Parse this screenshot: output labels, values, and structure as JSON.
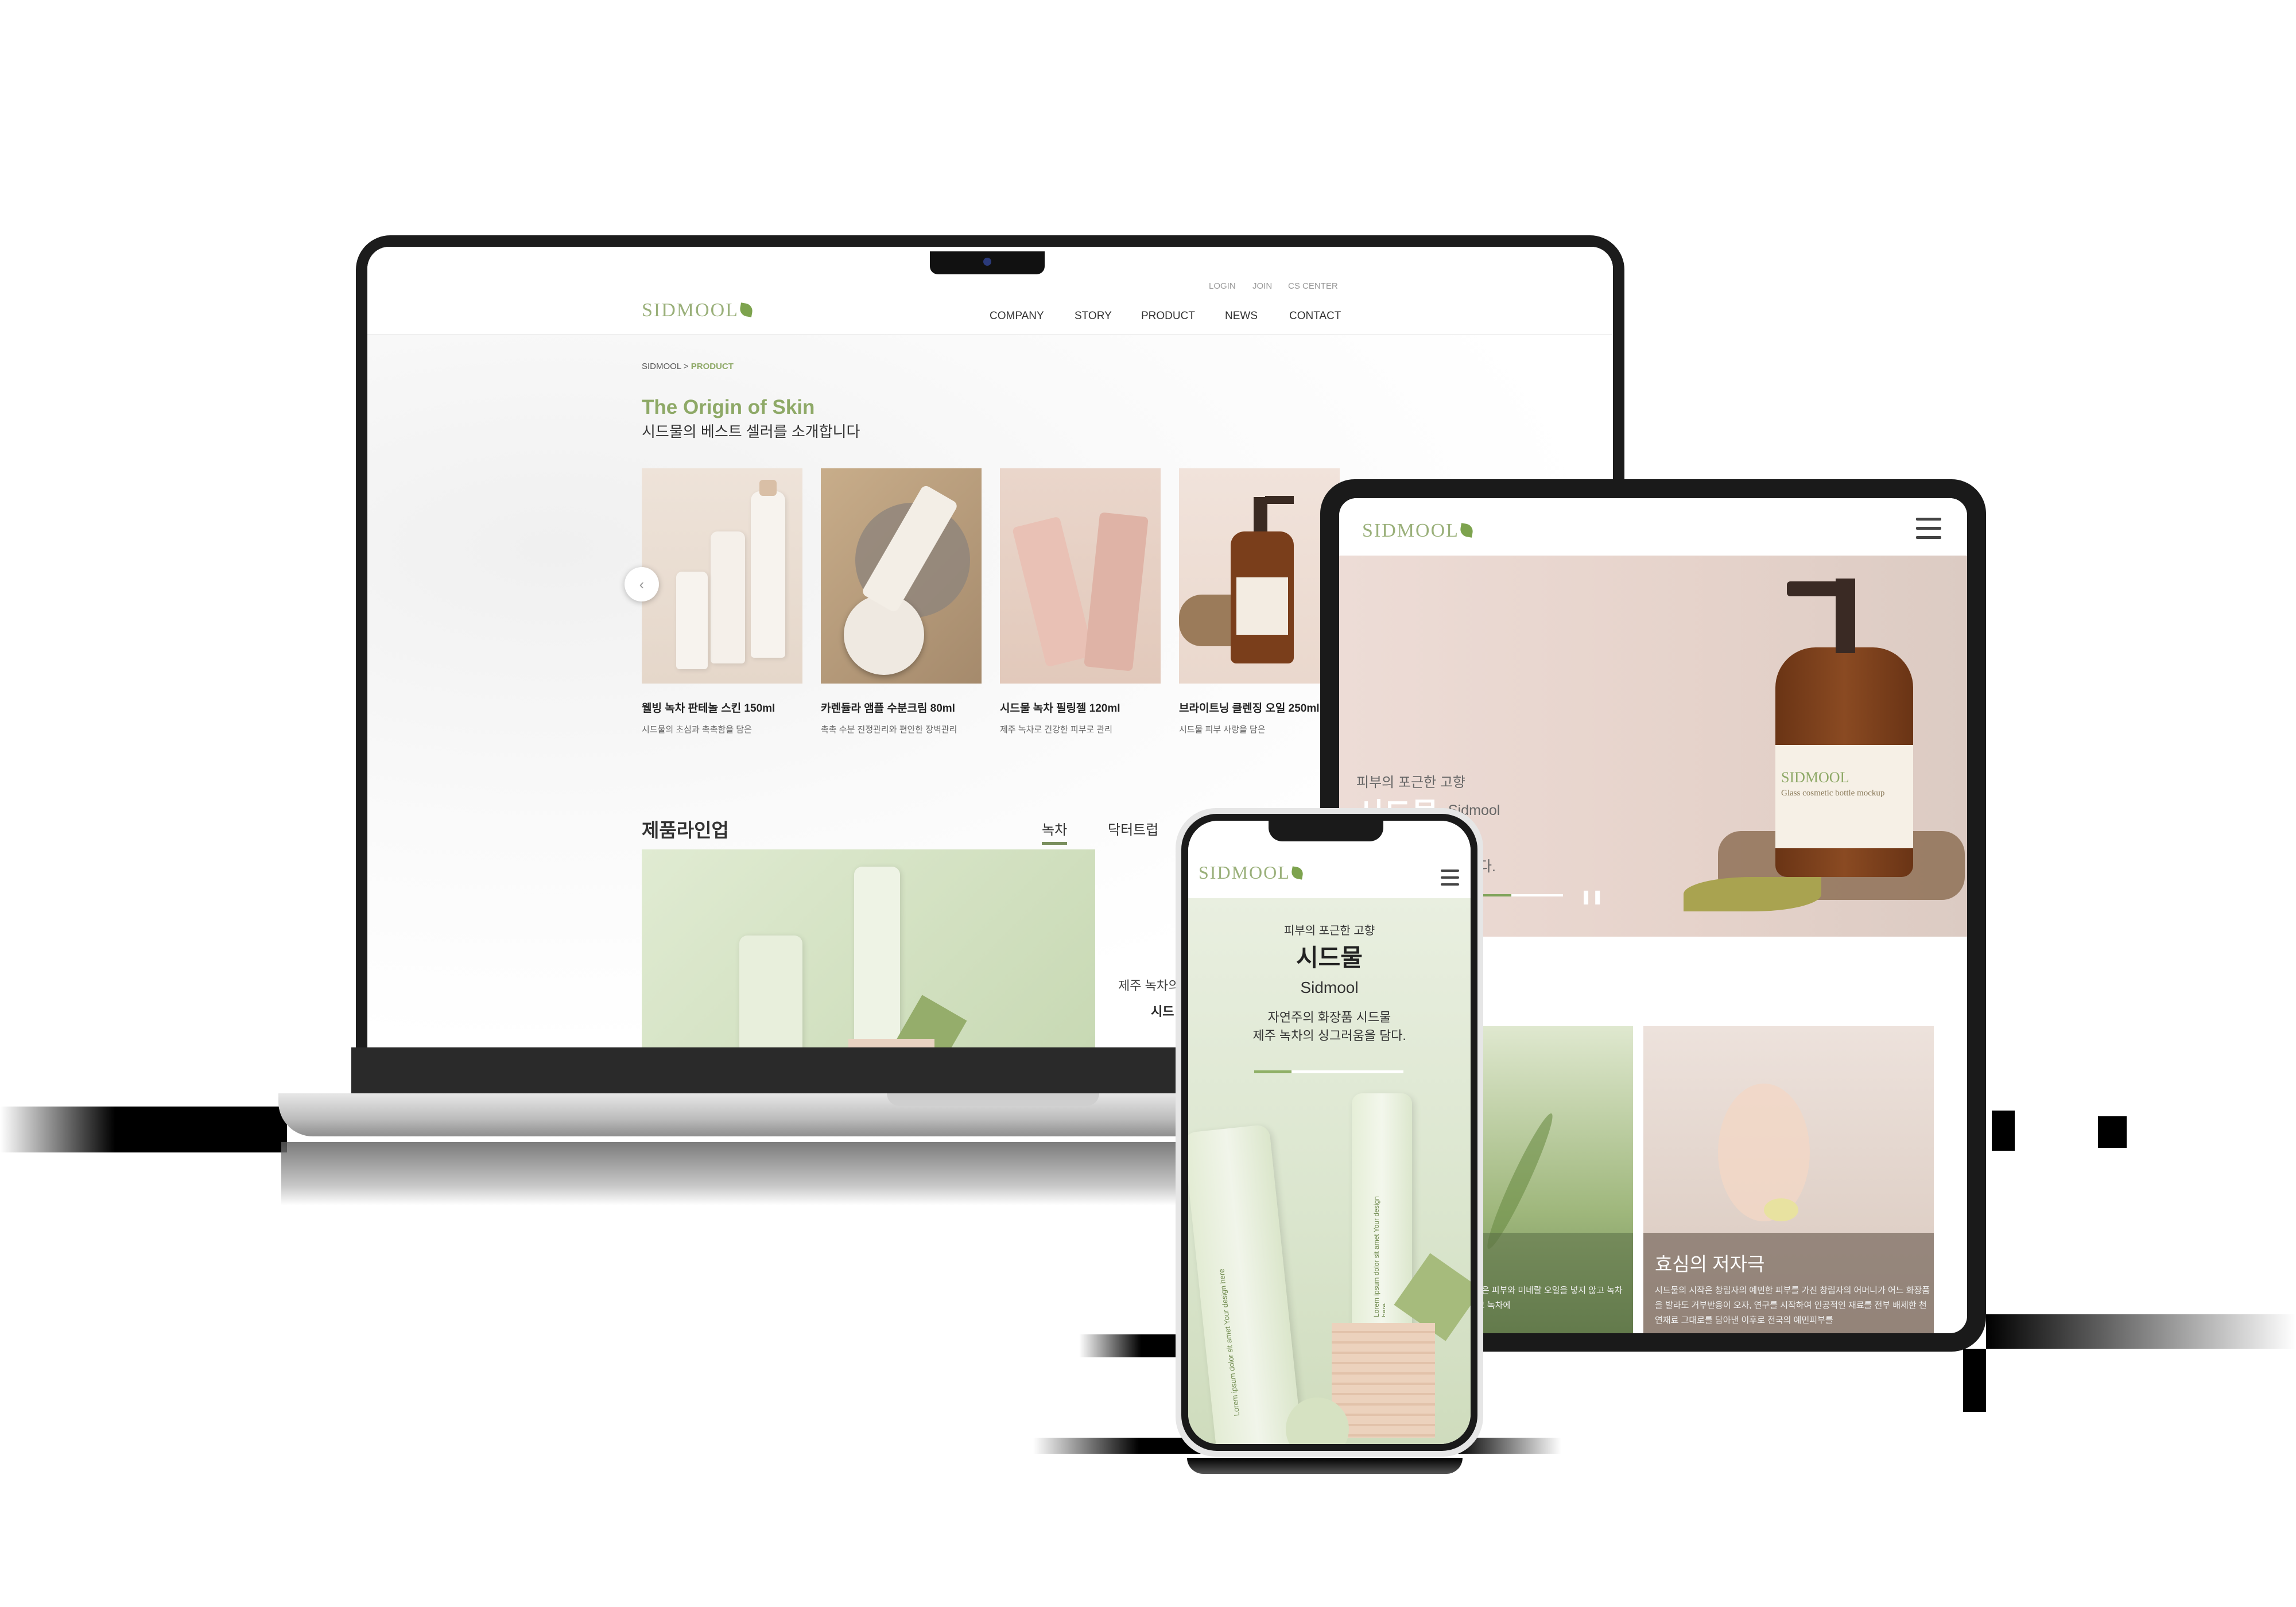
{
  "brand": {
    "logo": "SIDMOOL"
  },
  "colors": {
    "accent": "#8ea967",
    "dark_text": "#333333"
  },
  "laptop": {
    "utility_nav": [
      "LOGIN",
      "JOIN",
      "CS CENTER"
    ],
    "main_nav": [
      "COMPANY",
      "STORY",
      "PRODUCT",
      "NEWS",
      "CONTACT"
    ],
    "breadcrumb": {
      "home": "SIDMOOL",
      "separator": ">",
      "current": "PRODUCT"
    },
    "hero": {
      "title": "The Origin of Skin",
      "subtitle": "시드물의 베스트 셀러를 소개합니다"
    },
    "products": [
      {
        "name": "웰빙 녹차 판테놀 스킨 150ml",
        "desc": "시드물의 초심과 촉촉함을 담은"
      },
      {
        "name": "카렌듈라 앰플 수분크림 80ml",
        "desc": "촉촉 수분 진정관리와 편안한 장벽관리"
      },
      {
        "name": "시드물 녹차 필링젤 120ml",
        "desc": "제주 녹차로 건강한 피부로 관리"
      },
      {
        "name": "브라이트닝 클렌징 오일 250ml",
        "desc": "시드물 피부 사랑을 담은"
      }
    ],
    "prev_arrow": "‹",
    "lineup": {
      "title": "제품라인업",
      "tabs": [
        "녹차",
        "닥터트럽"
      ],
      "active_tab": 0,
      "text1": "제주 녹차의",
      "text2": "시드"
    }
  },
  "tablet": {
    "hero": {
      "sub": "피부의 포근한 고향",
      "title": "시드물",
      "line1": "Sidmool",
      "line2": "물",
      "line3": "을 담다.",
      "progress": 0.55,
      "bottle_brand": "SIDMOOL",
      "bottle_label": "Glass cosmetic bottle mockup"
    },
    "cards": [
      {
        "label": "것",
        "text": "에는 것에서 시작했습니다. 저희 제품은 피부와 미네랄 오일을 넣지 않고 녹차와 지 화장품 2001년에 만들게 되었고 녹차에"
      },
      {
        "label": "효심의 저자극",
        "text": "시드물의 시작은 창립자의 예민한 피부를 가진 창립자의 어머니가 어느 화장품을 발라도 거부반응이 오자, 연구를 시작하여 인공적인 재료를 전부 배제한 천연재료 그대로를 담아낸 이후로 전국의 예민피부를"
      }
    ]
  },
  "phone": {
    "hero": {
      "sub": "피부의 포근한 고향",
      "title": "시드물",
      "en": "Sidmool",
      "desc1": "자연주의 화장품 시드물",
      "desc2": "제주 녹차의 싱그러움을 담다.",
      "progress": 0.25,
      "tube_text": "Lorem ipsum dolor sit amet Your design here"
    }
  }
}
